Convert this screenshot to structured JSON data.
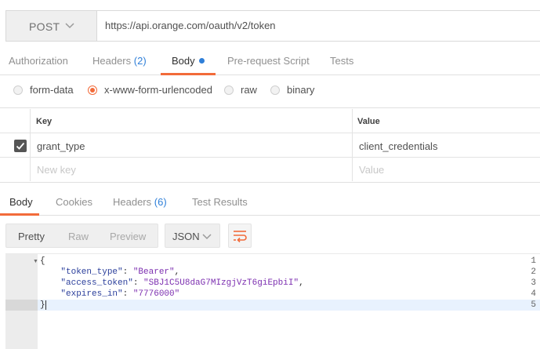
{
  "request": {
    "method": "POST",
    "url": "https://api.orange.com/oauth/v2/token"
  },
  "request_tabs": {
    "authorization": "Authorization",
    "headers": "Headers",
    "headers_count": "(2)",
    "body": "Body",
    "prerequest": "Pre-request Script",
    "tests": "Tests"
  },
  "body_types": {
    "form_data": "form-data",
    "urlencoded": "x-www-form-urlencoded",
    "raw": "raw",
    "binary": "binary",
    "selected": "x-www-form-urlencoded"
  },
  "params_table": {
    "key_header": "Key",
    "value_header": "Value",
    "rows": [
      {
        "key": "grant_type",
        "value": "client_credentials",
        "enabled": true
      }
    ],
    "new_key_placeholder": "New key",
    "new_value_placeholder": "Value"
  },
  "response_tabs": {
    "body": "Body",
    "cookies": "Cookies",
    "headers": "Headers",
    "headers_count": "(6)",
    "test_results": "Test Results"
  },
  "view_modes": {
    "pretty": "Pretty",
    "raw": "Raw",
    "preview": "Preview",
    "selected": "Pretty"
  },
  "format": "JSON",
  "response_body": {
    "line_numbers": [
      "1",
      "2",
      "3",
      "4",
      "5"
    ],
    "open_brace": "{",
    "close_brace": "}",
    "fields": [
      {
        "key": "\"token_type\"",
        "value": "\"Bearer\"",
        "sep": ",",
        "colon": ": "
      },
      {
        "key": "\"access_token\"",
        "value": "\"SBJ1C5U8daG7MIzgjVzT6giEpbiI\"",
        "sep": ",",
        "colon": ": "
      },
      {
        "key": "\"expires_in\"",
        "value": "\"7776000\"",
        "sep": "",
        "colon": ": "
      }
    ]
  },
  "colors": {
    "accent": "#f26b3a",
    "count_blue": "#2f7fd8",
    "json_key": "#2a3e9b",
    "json_string": "#7c2fb0"
  },
  "icons": {
    "method_dropdown": "chevron-down-icon",
    "format_dropdown": "chevron-down-icon",
    "wrap": "wrap-lines-icon",
    "checkbox": "check-icon",
    "body_modified": "dot-icon"
  }
}
